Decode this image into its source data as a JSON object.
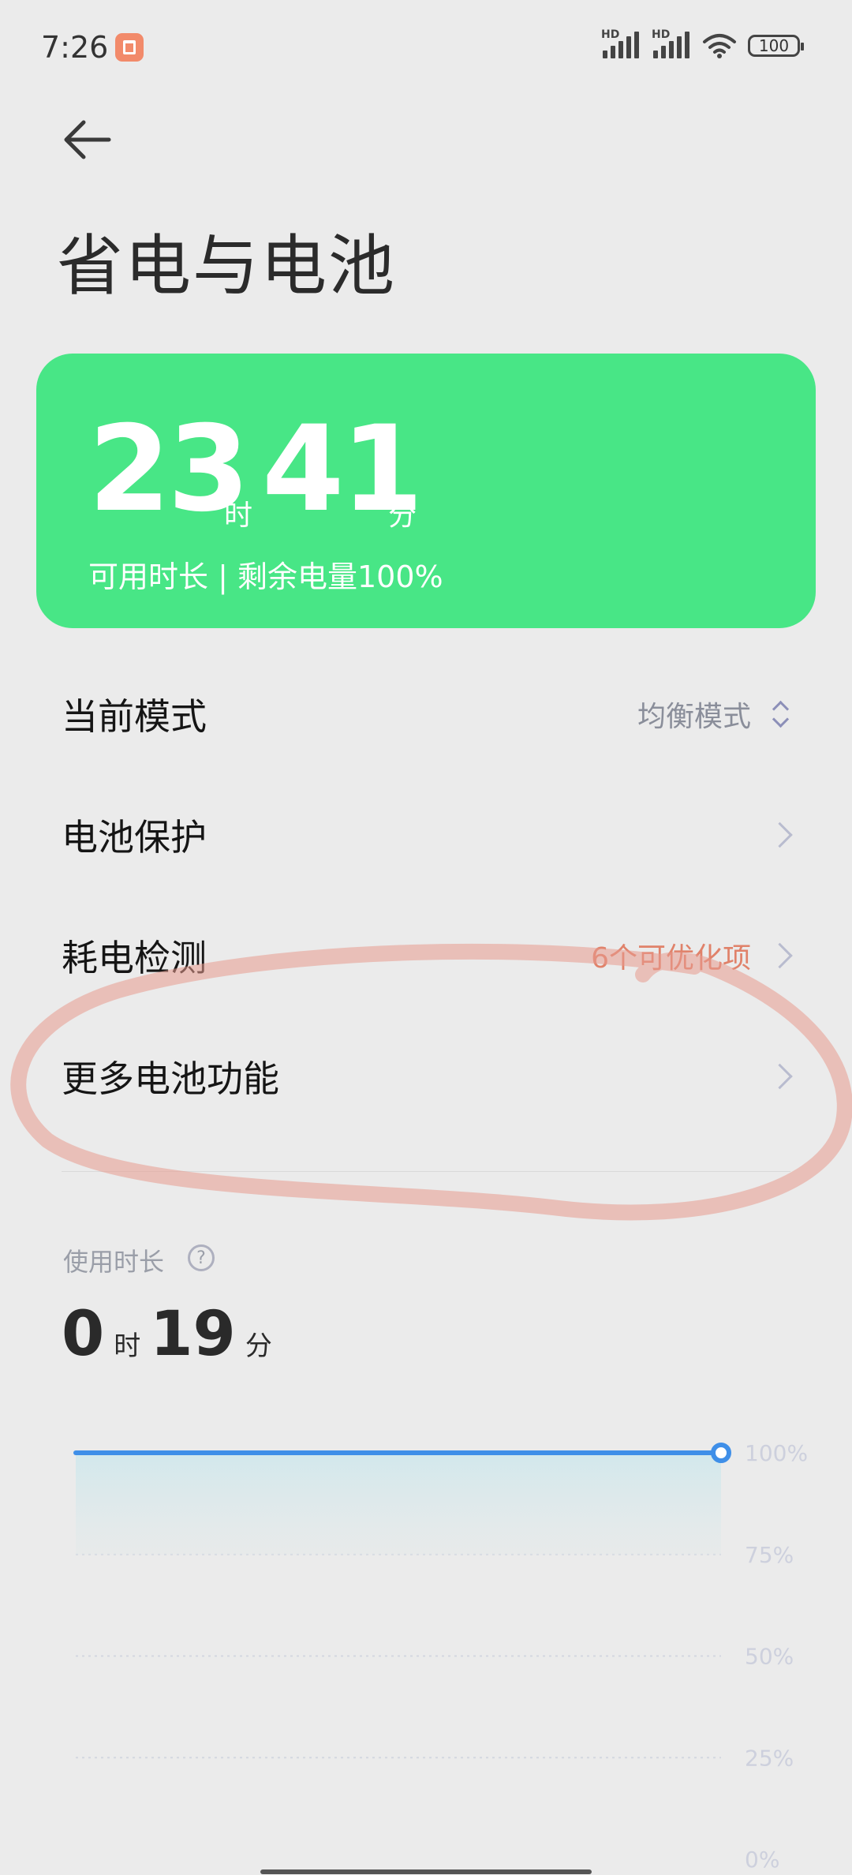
{
  "status": {
    "time": "7:26",
    "hd1": "HD",
    "hd2": "HD",
    "battery": "100"
  },
  "header": {
    "title": "省电与电池"
  },
  "summary": {
    "hours": "23",
    "hours_unit": "时",
    "minutes": "41",
    "minutes_unit": "分",
    "subtitle": "可用时长 | 剩余电量100%"
  },
  "rows": [
    {
      "label": "当前模式",
      "value": "均衡模式"
    },
    {
      "label": "电池保护",
      "value": ""
    },
    {
      "label": "耗电检测",
      "value": "6个可优化项"
    },
    {
      "label": "更多电池功能",
      "value": ""
    }
  ],
  "usage": {
    "label": "使用时长",
    "help": "?",
    "hours": "0",
    "hours_unit": "时",
    "minutes": "19",
    "minutes_unit": "分"
  },
  "colors": {
    "card": "#48e686",
    "line": "#3f8fe8",
    "warn": "#e0826a",
    "annotation": "#e89a8e"
  },
  "chart_data": {
    "type": "line",
    "yticks": [
      "100%",
      "75%",
      "50%",
      "25%",
      "0%"
    ],
    "ylim": [
      0,
      100
    ],
    "series": [
      {
        "values": [
          100,
          100
        ]
      }
    ]
  }
}
